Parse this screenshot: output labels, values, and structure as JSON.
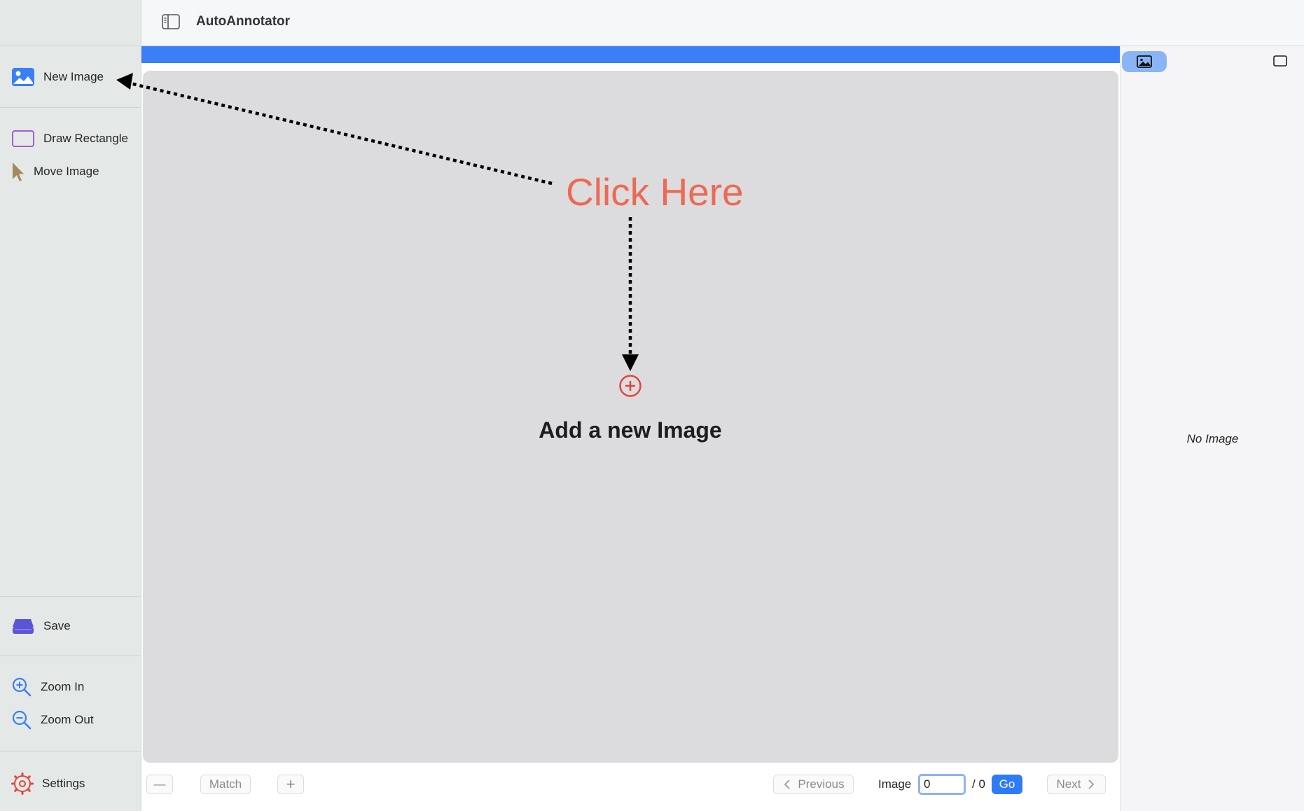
{
  "header": {
    "title": "AutoAnnotator"
  },
  "sidebar": {
    "new_image": "New Image",
    "draw_rectangle": "Draw Rectangle",
    "move_image": "Move Image",
    "save": "Save",
    "zoom_in": "Zoom In",
    "zoom_out": "Zoom Out",
    "settings": "Settings"
  },
  "progress": {
    "fraction": 1.0,
    "color": "#3a7ff6"
  },
  "canvas": {
    "callout": "Click Here",
    "add_label": "Add a new Image"
  },
  "right_panel": {
    "empty_text": "No Image"
  },
  "bottom_bar": {
    "zoom_out_symbol": "—",
    "match_label": "Match",
    "zoom_in_symbol": "+",
    "previous_label": "Previous",
    "image_label": "Image",
    "page_value": "0",
    "page_total": "/ 0",
    "go_label": "Go",
    "next_label": "Next"
  },
  "colors": {
    "accent": "#2f7bf5",
    "callout": "#ec6a53",
    "sidebar_bg": "#e4e9e8",
    "canvas_bg": "#dcdcde"
  }
}
